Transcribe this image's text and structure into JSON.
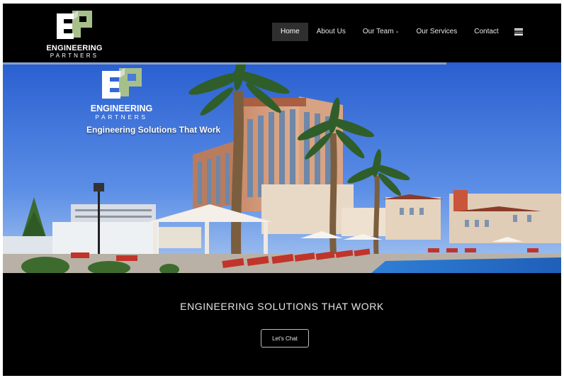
{
  "brand": {
    "name": "ENGINEERING",
    "sub": "PARTNERS",
    "colors": {
      "mark_green": "#a7c08a",
      "mark_white": "#ffffff",
      "background": "#000000"
    }
  },
  "nav": {
    "items": [
      {
        "label": "Home",
        "active": true
      },
      {
        "label": "About Us",
        "active": false
      },
      {
        "label": "Our Team",
        "active": false,
        "has_dropdown": true
      },
      {
        "label": "Our Services",
        "active": false
      },
      {
        "label": "Contact",
        "active": false
      }
    ],
    "menu_icon": "hamburger-menu-icon"
  },
  "hero": {
    "logo_name": "ENGINEERING",
    "logo_sub": "PARTNERS",
    "tagline": "Engineering Solutions That Work",
    "image": "resort-hotel-pool-with-palm-trees"
  },
  "bottom": {
    "heading": "ENGINEERING SOLUTIONS THAT WORK",
    "button_label": "Let's Chat"
  }
}
